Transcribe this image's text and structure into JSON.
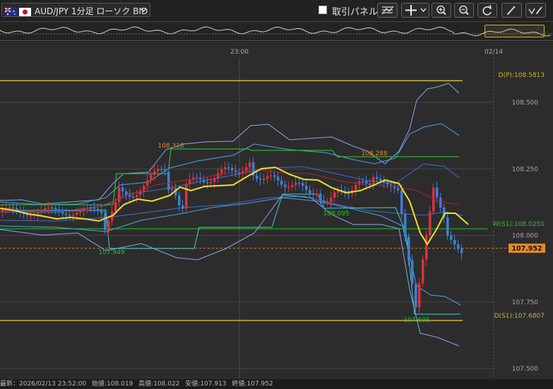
{
  "toolbar": {
    "symbol_label": "AUD/JPY  1分足 ローソク BID",
    "dropdown_icon": "chevron-down-icon",
    "checkbox_label": "取引パネル",
    "checkbox_checked": false,
    "buttons": [
      "indicator-settings-icon",
      "crosshair-icon",
      "chevron-down-icon",
      "zoom-in-icon",
      "zoom-out-icon",
      "refresh-icon",
      "pen-icon",
      "drawing-tools-icon"
    ]
  },
  "chart": {
    "time_labels": [
      "23:00",
      "02/14"
    ],
    "price_ticks": [
      "108.500",
      "108.250",
      "108.000",
      "107.750",
      "107.500"
    ],
    "current_price": "107.952",
    "pivot_lines": [
      {
        "label": "D(P):108.5813",
        "price": 108.5813
      },
      {
        "label": "W(S1):108.0250",
        "price": 108.025
      },
      {
        "label": "D(S1):107.6807",
        "price": 107.6807
      }
    ],
    "annotations": [
      "108.318",
      "108.288",
      "108.095",
      "107.949",
      "107.695"
    ],
    "colors": {
      "bull": "#d9333c",
      "bear": "#3f7ed8",
      "pivot": "#c6b434",
      "support": "#2bd02b",
      "ma": "#f0e026",
      "band": "#8aa6ee",
      "band_inner": "#4ea2e6",
      "teal": "#3ccfd0",
      "bg": "#2c2c2c"
    }
  },
  "status": {
    "latest": "最新：2026/02/13 23:52:00",
    "open": "始値:108.019",
    "high": "高値:108.022",
    "low": "安値:107.913",
    "close": "終値:107.952"
  }
}
